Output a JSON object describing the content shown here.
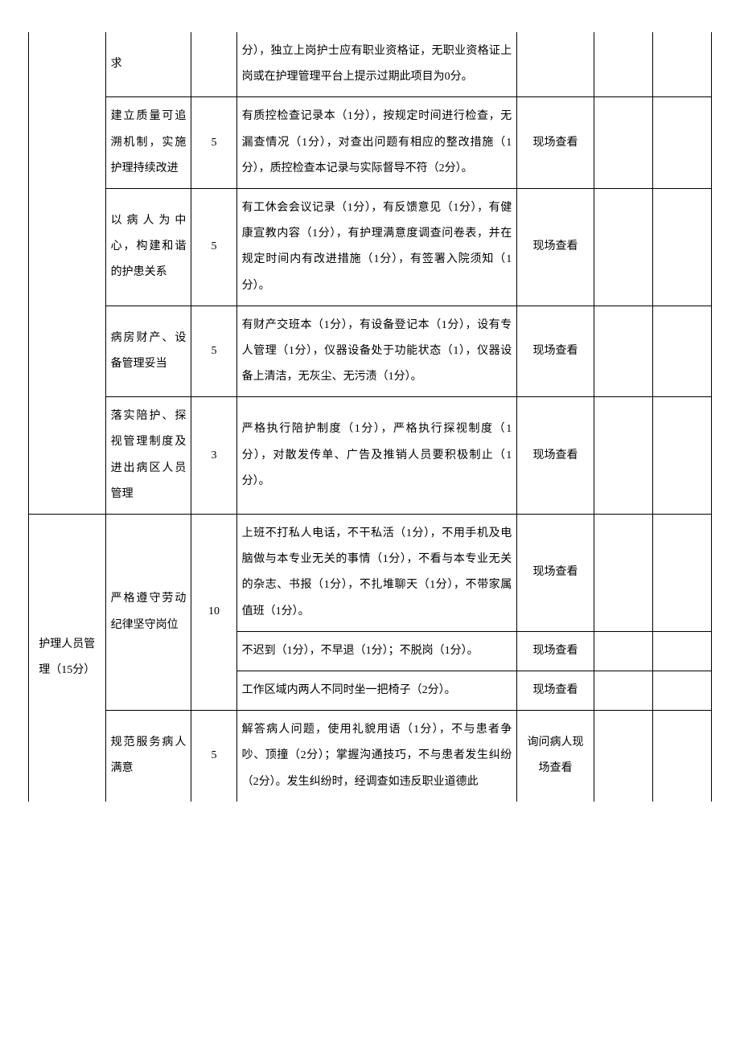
{
  "rows": [
    {
      "cat": "",
      "item": "求",
      "score": "",
      "criteria": "分），独立上岗护士应有职业资格证，无职业资格证上岗或在护理管理平台上提示过期此项目为0分。",
      "method": ""
    },
    {
      "item": "建立质量可追溯机制，实施护理持续改进",
      "score": "5",
      "criteria": "有质控检查记录本（1分），按规定时间进行检查，无漏查情况（1分），对查出问题有相应的整改措施（1分），质控检查本记录与实际督导不符（2分）。",
      "method": "现场查看"
    },
    {
      "item": "以病人为中心，构建和谐的护患关系",
      "score": "5",
      "criteria": "有工休会会议记录（1分），有反馈意见（1分），有健康宣教内容（1分），有护理满意度调查问卷表，并在规定时间内有改进措施（1分），有签署入院须知（1分）。",
      "method": "现场查看"
    },
    {
      "item": "病房财产、设备管理妥当",
      "score": "5",
      "criteria": "有财产交班本（1分），有设备登记本（1分），设有专人管理（1分），仪器设备处于功能状态（1），仪器设备上清洁，无灰尘、无污渍（1分）。",
      "method": "现场查看"
    },
    {
      "item": "落实陪护、探视管理制度及进出病区人员管理",
      "score": "3",
      "criteria": "严格执行陪护制度（1分），严格执行探视制度（1分），对散发传单、广告及推销人员要积极制止（1分）。",
      "method": "现场查看"
    },
    {
      "cat": "护理人员管理（15分）",
      "item": "严格遵守劳动纪律坚守岗位",
      "score": "10",
      "criteria": "上班不打私人电话，不干私活（1分），不用手机及电脑做与本专业无关的事情（1分），不看与本专业无关的杂志、书报（1分），不扎堆聊天（1分），不带家属值班（1分）。",
      "method": "现场查看"
    },
    {
      "criteria": "不迟到（1分），不早退（1分）；不脱岗（1分）。",
      "method": "现场查看"
    },
    {
      "criteria": "工作区域内两人不同时坐一把椅子（2分）。",
      "method": "现场查看"
    },
    {
      "item": "规范服务病人满意",
      "score": "5",
      "criteria": "解答病人问题，使用礼貌用语（1分），不与患者争吵、顶撞（2分）；掌握沟通技巧，不与患者发生纠纷（2分）。发生纠纷时，经调查如违反职业道德此",
      "method": "询问病人现场查看"
    }
  ]
}
